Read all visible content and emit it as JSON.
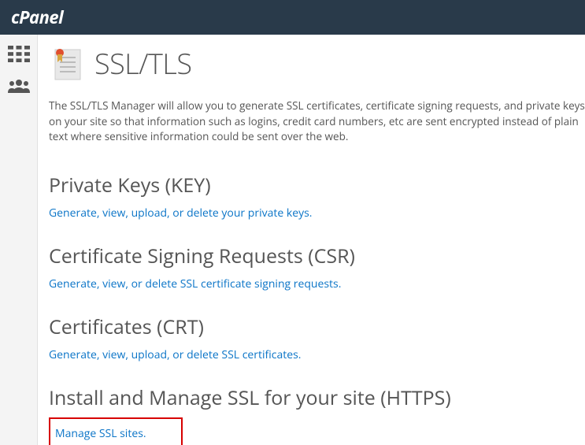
{
  "brand": "cPanel",
  "sidebar": {
    "items": [
      {
        "name": "apps-icon"
      },
      {
        "name": "users-icon"
      }
    ]
  },
  "page": {
    "title": "SSL/TLS",
    "intro": "The SSL/TLS Manager will allow you to generate SSL certificates, certificate signing requests, and private keys on your site so that information such as logins, credit card numbers, etc are sent encrypted instead of plain text where sensitive information could be sent over the web."
  },
  "sections": [
    {
      "heading": "Private Keys (KEY)",
      "link_text": "Generate, view, upload, or delete your private keys."
    },
    {
      "heading": "Certificate Signing Requests (CSR)",
      "link_text": "Generate, view, or delete SSL certificate signing requests."
    },
    {
      "heading": "Certificates (CRT)",
      "link_text": "Generate, view, upload, or delete SSL certificates."
    },
    {
      "heading": "Install and Manage SSL for your site (HTTPS)",
      "link_text": "Manage SSL sites."
    }
  ]
}
